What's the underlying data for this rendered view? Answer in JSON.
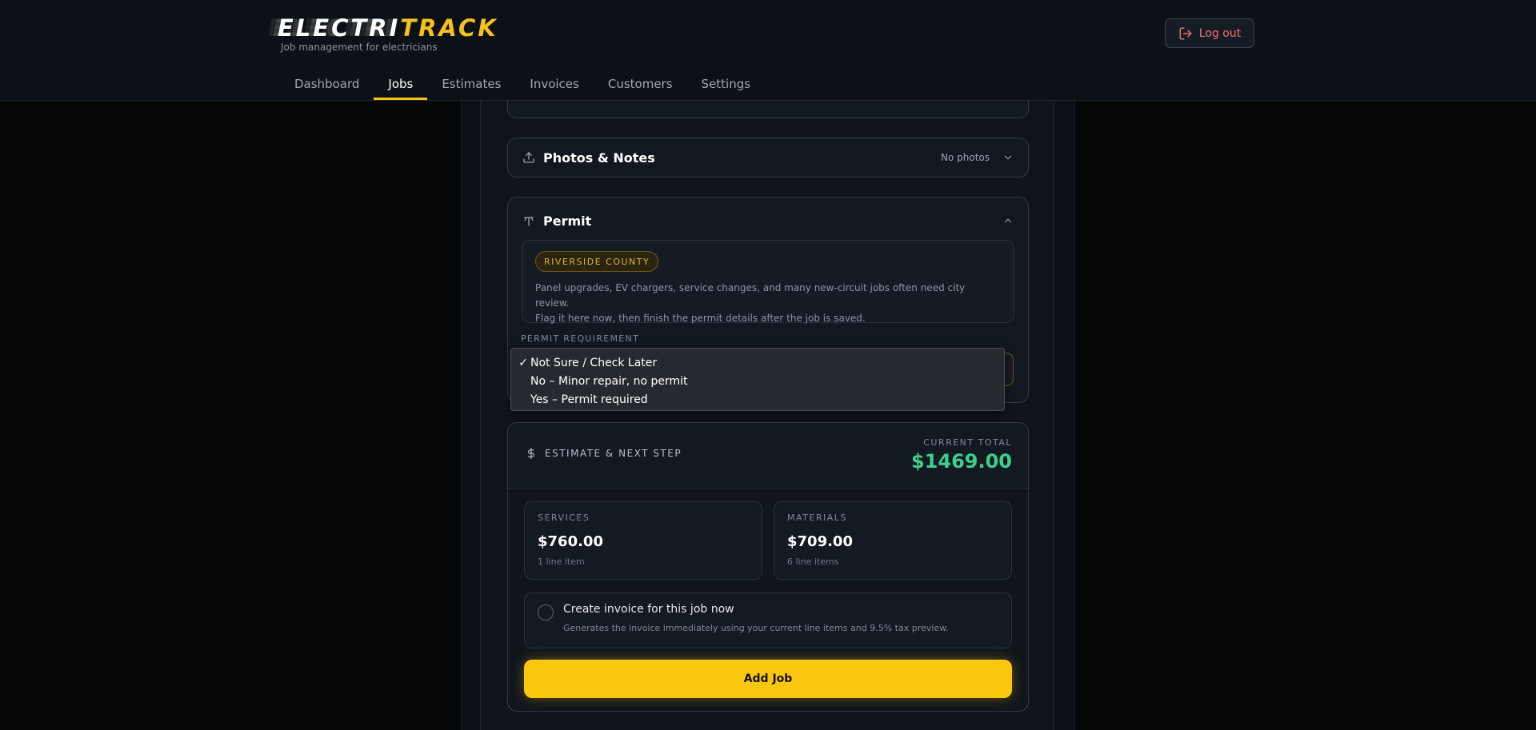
{
  "app": {
    "logo_part1": "ELECTRI",
    "logo_part2": "TRACK",
    "tagline": "Job management for electricians",
    "logout_label": "Log out"
  },
  "nav": {
    "tabs": [
      {
        "label": "Dashboard",
        "active": false
      },
      {
        "label": "Jobs",
        "active": true
      },
      {
        "label": "Estimates",
        "active": false
      },
      {
        "label": "Invoices",
        "active": false
      },
      {
        "label": "Customers",
        "active": false
      },
      {
        "label": "Settings",
        "active": false
      }
    ]
  },
  "photos": {
    "title": "Photos & Notes",
    "meta": "No photos",
    "icon": "upload-icon"
  },
  "permit": {
    "title": "Permit",
    "icon": "permit-icon",
    "county": "RIVERSIDE COUNTY",
    "desc_line1": "Panel upgrades, EV chargers, service changes, and many new-circuit jobs often need city review.",
    "desc_line2": "Flag it here now, then finish the permit details after the job is saved.",
    "requirement_label": "PERMIT REQUIREMENT",
    "options": [
      {
        "label": "Not Sure / Check Later",
        "selected": true
      },
      {
        "label": "No – Minor repair, no permit",
        "selected": false
      },
      {
        "label": "Yes – Permit required",
        "selected": false
      }
    ]
  },
  "estimate": {
    "title": "ESTIMATE & NEXT STEP",
    "total_label": "CURRENT TOTAL",
    "total_value": "$1469.00",
    "services_label": "SERVICES",
    "services_value": "$760.00",
    "services_sub": "1 line item",
    "materials_label": "MATERIALS",
    "materials_value": "$709.00",
    "materials_sub": "6 line items",
    "invoice_title": "Create invoice for this job now",
    "invoice_sub": "Generates the invoice immediately using your current line items and 9.5% tax preview.",
    "add_button": "Add Job"
  },
  "colors": {
    "accent": "#fbc70f",
    "total_green": "#3ecf8e",
    "logout_red": "#f0716e"
  }
}
